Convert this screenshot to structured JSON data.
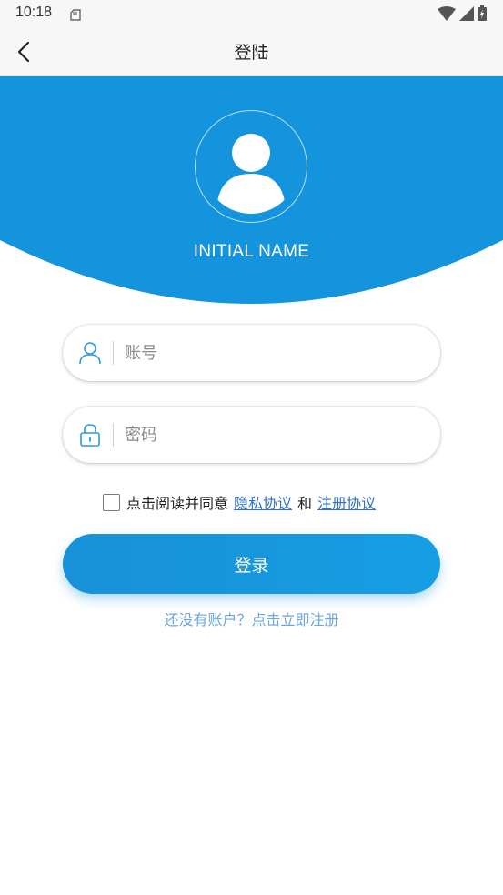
{
  "status_bar": {
    "time": "10:18"
  },
  "app_bar": {
    "title": "登陆"
  },
  "profile": {
    "name": "INITIAL NAME"
  },
  "form": {
    "account_placeholder": "账号",
    "password_placeholder": "密码"
  },
  "agreement": {
    "prefix": "点击阅读并同意",
    "privacy_link": "隐私协议",
    "conjunction": "和",
    "register_link": "注册协议",
    "checked": false
  },
  "login_button": {
    "label": "登录"
  },
  "register_prompt": {
    "text": "还没有账户？点击立即注册"
  },
  "colors": {
    "brand_blue": "#1394dd",
    "link_blue": "#2f6fcf",
    "register_text": "#6fa6dc"
  },
  "icons": {
    "back": "chevron-left-icon",
    "avatar": "user-avatar-icon",
    "account": "user-icon",
    "password": "lock-icon",
    "wifi": "wifi-icon",
    "signal": "signal-icon",
    "battery": "battery-icon",
    "notification": "notification-icon"
  }
}
